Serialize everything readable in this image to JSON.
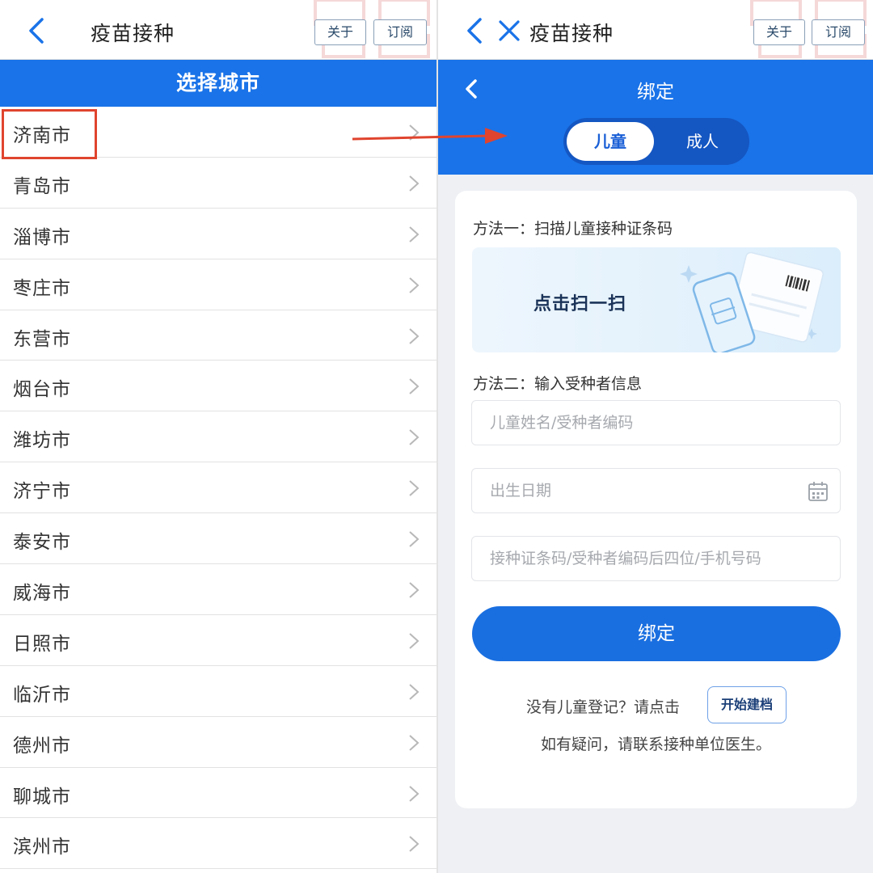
{
  "left": {
    "app_title": "疫苗接种",
    "about_label": "关于",
    "subscribe_label": "订阅",
    "city_header": "选择城市",
    "cities": [
      "济南市",
      "青岛市",
      "淄博市",
      "枣庄市",
      "东营市",
      "烟台市",
      "潍坊市",
      "济宁市",
      "泰安市",
      "威海市",
      "日照市",
      "临沂市",
      "德州市",
      "聊城市",
      "滨州市"
    ],
    "selected_city": "济南市"
  },
  "right": {
    "app_title": "疫苗接种",
    "about_label": "关于",
    "subscribe_label": "订阅",
    "page_title": "绑定",
    "tabs": {
      "child": "儿童",
      "adult": "成人",
      "active": "儿童"
    },
    "method1_label": "方法一：扫描儿童接种证条码",
    "scan_label": "点击扫一扫",
    "method2_label": "方法二：输入受种者信息",
    "fields": {
      "name_placeholder": "儿童姓名/受种者编码",
      "birth_placeholder": "出生日期",
      "code_placeholder": "接种证条码/受种者编码后四位/手机号码"
    },
    "bind_button": "绑定",
    "register_prompt": "没有儿童登记？请点击",
    "register_button": "开始建档",
    "help_text": "如有疑问，请联系接种单位医生。"
  },
  "colors": {
    "primary_blue": "#1a73e8",
    "highlight_red": "#e0442e"
  }
}
